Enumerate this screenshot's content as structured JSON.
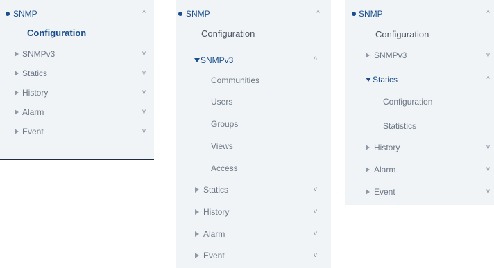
{
  "panel1": {
    "root": {
      "label": "SNMP",
      "chevron": "^"
    },
    "configuration": "Configuration",
    "items": [
      {
        "label": "SNMPv3",
        "chevron": "v"
      },
      {
        "label": "Statics",
        "chevron": "v"
      },
      {
        "label": "History",
        "chevron": "v"
      },
      {
        "label": "Alarm",
        "chevron": "v"
      },
      {
        "label": "Event",
        "chevron": "v"
      }
    ]
  },
  "panel2": {
    "root": {
      "label": "SNMP",
      "chevron": "^"
    },
    "configuration": "Configuration",
    "expanded": {
      "label": "SNMPv3",
      "chevron": "^"
    },
    "children": [
      "Communities",
      "Users",
      "Groups",
      "Views",
      "Access"
    ],
    "items": [
      {
        "label": "Statics",
        "chevron": "v"
      },
      {
        "label": "History",
        "chevron": "v"
      },
      {
        "label": "Alarm",
        "chevron": "v"
      },
      {
        "label": "Event",
        "chevron": "v"
      }
    ]
  },
  "panel3": {
    "root": {
      "label": "SNMP",
      "chevron": "^"
    },
    "configuration": "Configuration",
    "items_before": [
      {
        "label": "SNMPv3",
        "chevron": "v"
      }
    ],
    "expanded": {
      "label": "Statics",
      "chevron": "^"
    },
    "children": [
      "Configuration",
      "Statistics"
    ],
    "items_after": [
      {
        "label": "History",
        "chevron": "v"
      },
      {
        "label": "Alarm",
        "chevron": "v"
      },
      {
        "label": "Event",
        "chevron": "v"
      }
    ]
  },
  "colors": {
    "panel_bg": "#f1f4f7",
    "accent": "#1a4f8c",
    "muted_text": "#6c7886",
    "chevron": "#8b97a6"
  }
}
